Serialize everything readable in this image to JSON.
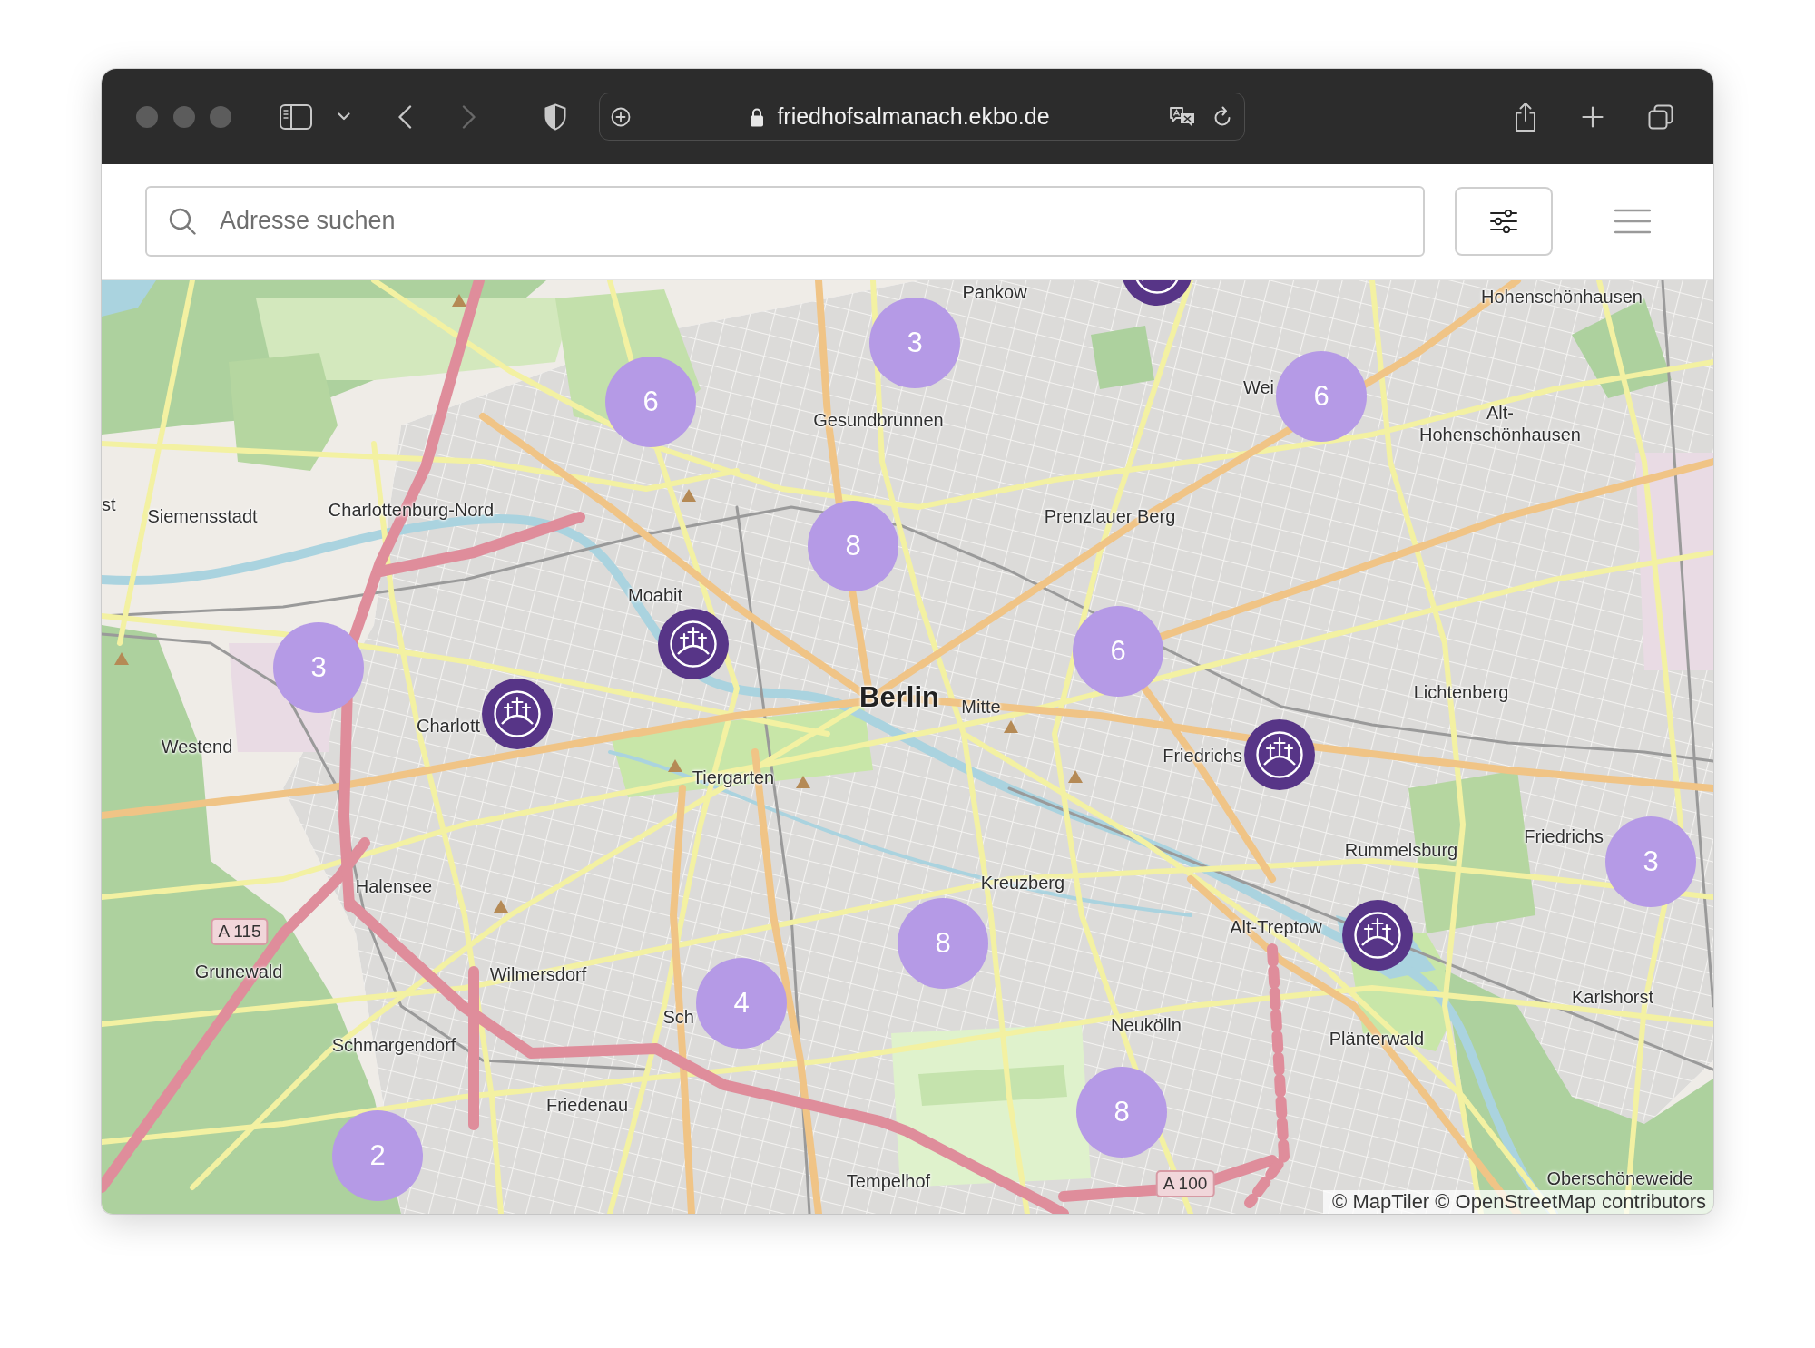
{
  "browser": {
    "url": "friedhofsalmanach.ekbo.de",
    "forward_enabled": false
  },
  "page_header": {
    "search": {
      "placeholder": "Adresse suchen"
    }
  },
  "map": {
    "labels": [
      {
        "text": "Pankow",
        "kind": "place"
      },
      {
        "text": "Hohenschönhausen",
        "kind": "place"
      },
      {
        "text": "Gesundbrunnen",
        "kind": "place"
      },
      {
        "text": "Wei",
        "kind": "place"
      },
      {
        "text": "Alt-Hohenschönhausen",
        "kind": "place"
      },
      {
        "text": "st",
        "kind": "place"
      },
      {
        "text": "Siemensstadt",
        "kind": "place"
      },
      {
        "text": "Charlottenburg-Nord",
        "kind": "place"
      },
      {
        "text": "Prenzlauer Berg",
        "kind": "place"
      },
      {
        "text": "Moabit",
        "kind": "place"
      },
      {
        "text": "Berlin",
        "kind": "city"
      },
      {
        "text": "Mitte",
        "kind": "place"
      },
      {
        "text": "Lichtenberg",
        "kind": "place"
      },
      {
        "text": "Charlott",
        "kind": "place"
      },
      {
        "text": "Westend",
        "kind": "place"
      },
      {
        "text": "Tiergarten",
        "kind": "place"
      },
      {
        "text": "Friedrichs",
        "kind": "place"
      },
      {
        "text": "Rummelsburg",
        "kind": "place"
      },
      {
        "text": "Friedrichs",
        "kind": "place"
      },
      {
        "text": "Halensee",
        "kind": "place"
      },
      {
        "text": "Kreuzberg",
        "kind": "place"
      },
      {
        "text": "A 115",
        "kind": "shield"
      },
      {
        "text": "Alt-Treptow",
        "kind": "place"
      },
      {
        "text": "Grunewald",
        "kind": "place"
      },
      {
        "text": "Wilmersdorf",
        "kind": "place"
      },
      {
        "text": "Sch",
        "kind": "place"
      },
      {
        "text": "Karlshorst",
        "kind": "place"
      },
      {
        "text": "Neukölln",
        "kind": "place"
      },
      {
        "text": "Schmargendorf",
        "kind": "place"
      },
      {
        "text": "Plänterwald",
        "kind": "place"
      },
      {
        "text": "Friedenau",
        "kind": "place"
      },
      {
        "text": "Tempelhof",
        "kind": "place"
      },
      {
        "text": "A 100",
        "kind": "shield"
      },
      {
        "text": "Oberschöneweide",
        "kind": "place"
      }
    ],
    "markers": [
      {
        "kind": "cemetery"
      },
      {
        "kind": "cluster",
        "count": "3"
      },
      {
        "kind": "cluster",
        "count": "6"
      },
      {
        "kind": "cluster",
        "count": "6"
      },
      {
        "kind": "cluster",
        "count": "8"
      },
      {
        "kind": "cemetery"
      },
      {
        "kind": "cluster",
        "count": "6"
      },
      {
        "kind": "cluster",
        "count": "3"
      },
      {
        "kind": "cemetery"
      },
      {
        "kind": "cemetery"
      },
      {
        "kind": "cluster",
        "count": "3"
      },
      {
        "kind": "cemetery"
      },
      {
        "kind": "cluster",
        "count": "8"
      },
      {
        "kind": "cluster",
        "count": "4"
      },
      {
        "kind": "cluster",
        "count": "8"
      },
      {
        "kind": "cluster",
        "count": "2"
      }
    ],
    "attribution": "© MapTiler © OpenStreetMap contributors"
  }
}
